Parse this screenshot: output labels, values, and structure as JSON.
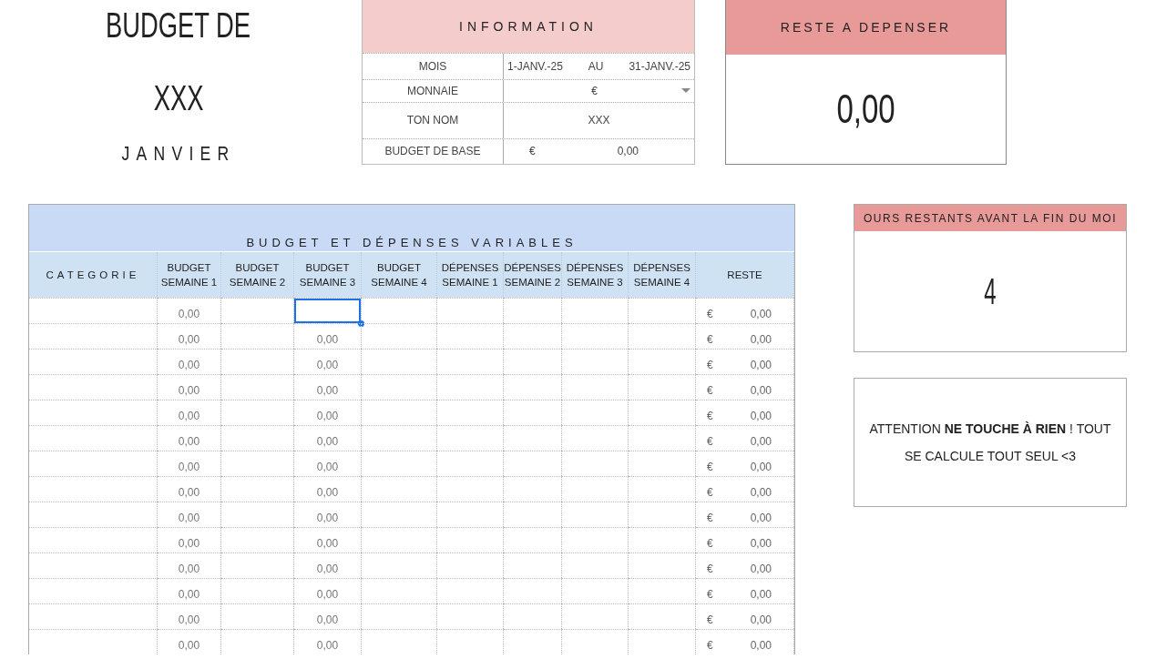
{
  "title": {
    "line_1": "BUDGET DE",
    "line_2": "XXX",
    "month": "JANVIER"
  },
  "information": {
    "heading": "INFORMATION",
    "rows": [
      {
        "kind": "dates",
        "label": "MOIS",
        "start": "1-JANV.-25",
        "separator": "AU",
        "end": "31-JANV.-25"
      },
      {
        "kind": "dropdown",
        "label": "MONNAIE",
        "value": "€"
      },
      {
        "kind": "text",
        "label": "TON NOM",
        "value": "XXX"
      },
      {
        "kind": "amount",
        "label": "BUDGET DE BASE",
        "currency": "€",
        "value": "0,00"
      }
    ]
  },
  "reste_a_depenser": {
    "heading": "RESTE A DEPENSER",
    "value": "0,00"
  },
  "table": {
    "title": "BUDGET ET DÉPENSES VARIABLES",
    "columns": [
      {
        "line_1": "CATEGORIE"
      },
      {
        "line_1": "BUDGET",
        "line_2": "SEMAINE 1"
      },
      {
        "line_1": "BUDGET",
        "line_2": "SEMAINE 2"
      },
      {
        "line_1": "BUDGET",
        "line_2": "SEMAINE 3"
      },
      {
        "line_1": "BUDGET",
        "line_2": "SEMAINE 4"
      },
      {
        "line_1": "DÉPENSES",
        "line_2": "SEMAINE 1"
      },
      {
        "line_1": "DÉPENSES",
        "line_2": "SEMAINE 2"
      },
      {
        "line_1": "DÉPENSES",
        "line_2": "SEMAINE 3"
      },
      {
        "line_1": "DÉPENSES",
        "line_2": "SEMAINE 4"
      },
      {
        "line_1": "RESTE"
      }
    ],
    "rows": [
      {
        "budget_semaine_1": "0,00",
        "currency": "€",
        "reste": "0,00",
        "selected": true
      },
      {
        "budget_semaine_1": "0,00",
        "budget_semaine_3": "0,00",
        "currency": "€",
        "reste": "0,00",
        "selected": false
      },
      {
        "budget_semaine_1": "0,00",
        "budget_semaine_3": "0,00",
        "currency": "€",
        "reste": "0,00",
        "selected": false
      },
      {
        "budget_semaine_1": "0,00",
        "budget_semaine_3": "0,00",
        "currency": "€",
        "reste": "0,00",
        "selected": false
      },
      {
        "budget_semaine_1": "0,00",
        "budget_semaine_3": "0,00",
        "currency": "€",
        "reste": "0,00",
        "selected": false
      },
      {
        "budget_semaine_1": "0,00",
        "budget_semaine_3": "0,00",
        "currency": "€",
        "reste": "0,00",
        "selected": false
      },
      {
        "budget_semaine_1": "0,00",
        "budget_semaine_3": "0,00",
        "currency": "€",
        "reste": "0,00",
        "selected": false
      },
      {
        "budget_semaine_1": "0,00",
        "budget_semaine_3": "0,00",
        "currency": "€",
        "reste": "0,00",
        "selected": false
      },
      {
        "budget_semaine_1": "0,00",
        "budget_semaine_3": "0,00",
        "currency": "€",
        "reste": "0,00",
        "selected": false
      },
      {
        "budget_semaine_1": "0,00",
        "budget_semaine_3": "0,00",
        "currency": "€",
        "reste": "0,00",
        "selected": false
      },
      {
        "budget_semaine_1": "0,00",
        "budget_semaine_3": "0,00",
        "currency": "€",
        "reste": "0,00",
        "selected": false
      },
      {
        "budget_semaine_1": "0,00",
        "budget_semaine_3": "0,00",
        "currency": "€",
        "reste": "0,00",
        "selected": false
      },
      {
        "budget_semaine_1": "0,00",
        "budget_semaine_3": "0,00",
        "currency": "€",
        "reste": "0,00",
        "selected": false
      },
      {
        "budget_semaine_1": "0,00",
        "budget_semaine_3": "0,00",
        "currency": "€",
        "reste": "0,00",
        "selected": false
      }
    ]
  },
  "jours_restants": {
    "heading": "OURS RESTANTS AVANT LA FIN DU MOI",
    "value": "4"
  },
  "note": {
    "text": "ATTENTION **NE TOUCHE À RIEN** ! TOUT SE CALCULE TOUT SEUL <3"
  }
}
